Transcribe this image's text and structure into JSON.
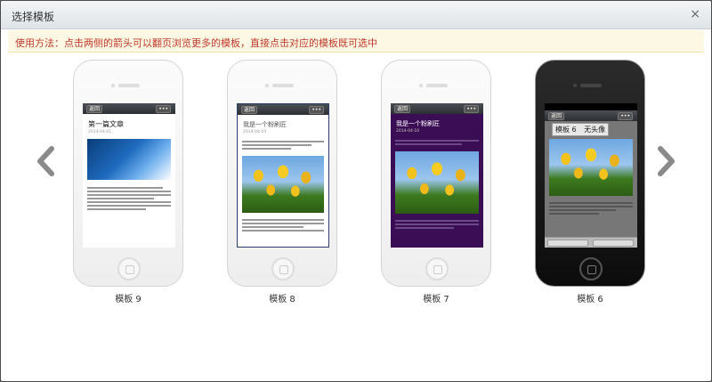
{
  "dialog": {
    "title": "选择模板",
    "close_symbol": "×"
  },
  "notice": "使用方法：点击两侧的箭头可以翻页浏览更多的模板，直接点击对应的模板既可选中",
  "templates": [
    {
      "label": "模板 9",
      "back": "返回",
      "more": "•••",
      "article_title": "第一篇文章",
      "date": "2014-04-01"
    },
    {
      "label": "模板 8",
      "back": "返回",
      "more": "•••",
      "article_title": "我是一个粉刷匠",
      "date": "2014-04-10"
    },
    {
      "label": "模板 7",
      "back": "返回",
      "more": "•••",
      "article_title": "我是一个粉刷匠",
      "date": "2014-04-10"
    },
    {
      "label": "模板 6",
      "back": "返回",
      "more": "•••",
      "tooltip_name": "模板 6",
      "tooltip_sub": "无头像"
    }
  ],
  "icons": {
    "prev": "chevron-left-icon",
    "next": "chevron-right-icon"
  },
  "colors": {
    "notice_text": "#c0392b",
    "notice_bg": "#fcf8e3",
    "purple_theme": "#3a0d55"
  }
}
